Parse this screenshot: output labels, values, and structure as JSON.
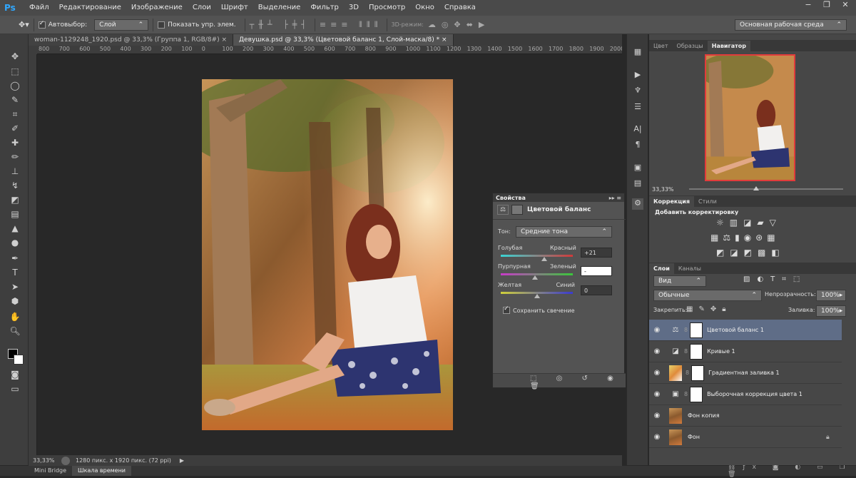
{
  "app": {
    "logo": "Ps"
  },
  "menu": [
    "Файл",
    "Редактирование",
    "Изображение",
    "Слои",
    "Шрифт",
    "Выделение",
    "Фильтр",
    "3D",
    "Просмотр",
    "Окно",
    "Справка"
  ],
  "options": {
    "autoselect_label": "Автовыбор:",
    "autoselect_value": "Слой",
    "show_controls_label": "Показать упр. элем.",
    "mode3d_label": "3D-режим:",
    "workspace": "Основная рабочая среда"
  },
  "doc_tabs": [
    {
      "label": "woman-1129248_1920.psd @ 33,3% (Группа 1, RGB/8#)",
      "close": "×"
    },
    {
      "label": "Девушка.psd @ 33,3% (Цветовой баланс 1, Слой-маска/8) *",
      "close": "×"
    }
  ],
  "ruler_ticks": [
    "800",
    "700",
    "600",
    "500",
    "400",
    "300",
    "200",
    "100",
    "0",
    "100",
    "200",
    "300",
    "400",
    "500",
    "600",
    "700",
    "800",
    "900",
    "1000",
    "1100",
    "1200",
    "1300",
    "1400",
    "1500",
    "1600",
    "1700",
    "1800",
    "1900",
    "2000"
  ],
  "status": {
    "zoom": "33,33%",
    "doc_info": "1280 пикс. x 1920 пикс. (72 ppi)"
  },
  "bottom_tabs": [
    "Mini Bridge",
    "Шкала времени"
  ],
  "navigator": {
    "tabs": [
      "Цвет",
      "Образцы",
      "Навигатор"
    ],
    "zoom": "33,33%"
  },
  "adjustments": {
    "tabs": [
      "Коррекция",
      "Стили"
    ],
    "title": "Добавить корректировку"
  },
  "layers": {
    "tabs": [
      "Слои",
      "Каналы"
    ],
    "filter": "Вид",
    "blend_mode": "Обычные",
    "opacity_label": "Непрозрачность:",
    "opacity": "100%",
    "lock_label": "Закрепить:",
    "fill_label": "Заливка:",
    "fill": "100%",
    "items": [
      {
        "name": "Цветовой баланс 1",
        "selected": true
      },
      {
        "name": "Кривые 1",
        "selected": false
      },
      {
        "name": "Градиентная заливка 1",
        "selected": false
      },
      {
        "name": "Выборочная коррекция цвета 1",
        "selected": false
      },
      {
        "name": "Фон копия",
        "selected": false
      },
      {
        "name": "Фон",
        "selected": false
      }
    ]
  },
  "properties": {
    "tab": "Свойства",
    "title": "Цветовой баланс",
    "tone_label": "Тон:",
    "tone_value": "Средние тона",
    "sliders": [
      {
        "left": "Голубая",
        "right": "Красный",
        "value": "+21",
        "level": 0.6
      },
      {
        "left": "Пурпурная",
        "right": "Зеленый",
        "value": "-",
        "level": 0.48
      },
      {
        "left": "Желтая",
        "right": "Синий",
        "value": "0",
        "level": 0.5
      }
    ],
    "preserve_label": "Сохранить свечение"
  },
  "colors": {
    "accent": "#31a8ff",
    "selected_layer": "#5f6d87",
    "nav_frame": "#e23b3b"
  }
}
